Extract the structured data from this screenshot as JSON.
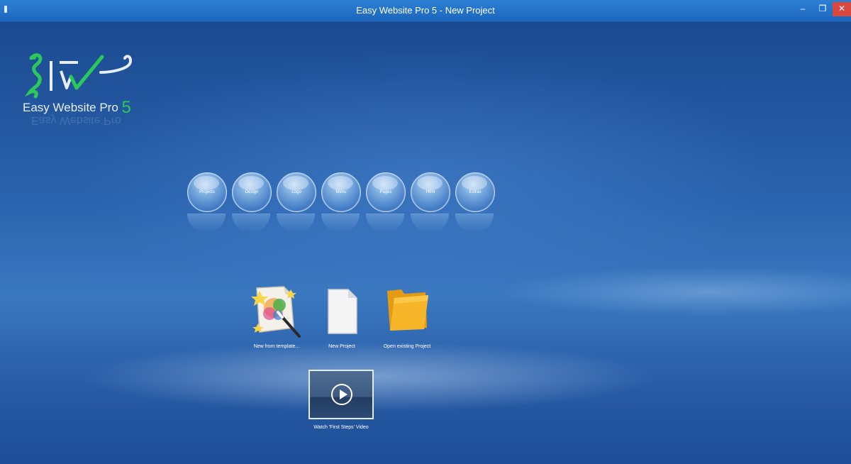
{
  "window": {
    "title": "Easy Website Pro 5 - New Project",
    "minimize": "–",
    "maximize": "❐",
    "close": "✕"
  },
  "logo": {
    "name": "Easy Website Pro",
    "version": "5",
    "icon": "seahorse-logo-icon"
  },
  "nav": {
    "items": [
      {
        "label": "Projects"
      },
      {
        "label": "Design"
      },
      {
        "label": "Logo"
      },
      {
        "label": "Menu"
      },
      {
        "label": "Pages"
      },
      {
        "label": "Html"
      },
      {
        "label": "Extras"
      }
    ]
  },
  "actions": {
    "template": {
      "label": "New from template...",
      "icon": "template-magic-wand-icon"
    },
    "new_project": {
      "label": "New Project",
      "icon": "blank-document-icon"
    },
    "open_project": {
      "label": "Open existing Project",
      "icon": "folder-icon"
    },
    "video": {
      "label": "Watch 'First Steps' Video",
      "icon": "play-icon"
    }
  },
  "colors": {
    "accent_green": "#2cc85a",
    "titlebar": "#1c66bd",
    "close": "#d9473f",
    "background": "#2a63ad"
  }
}
